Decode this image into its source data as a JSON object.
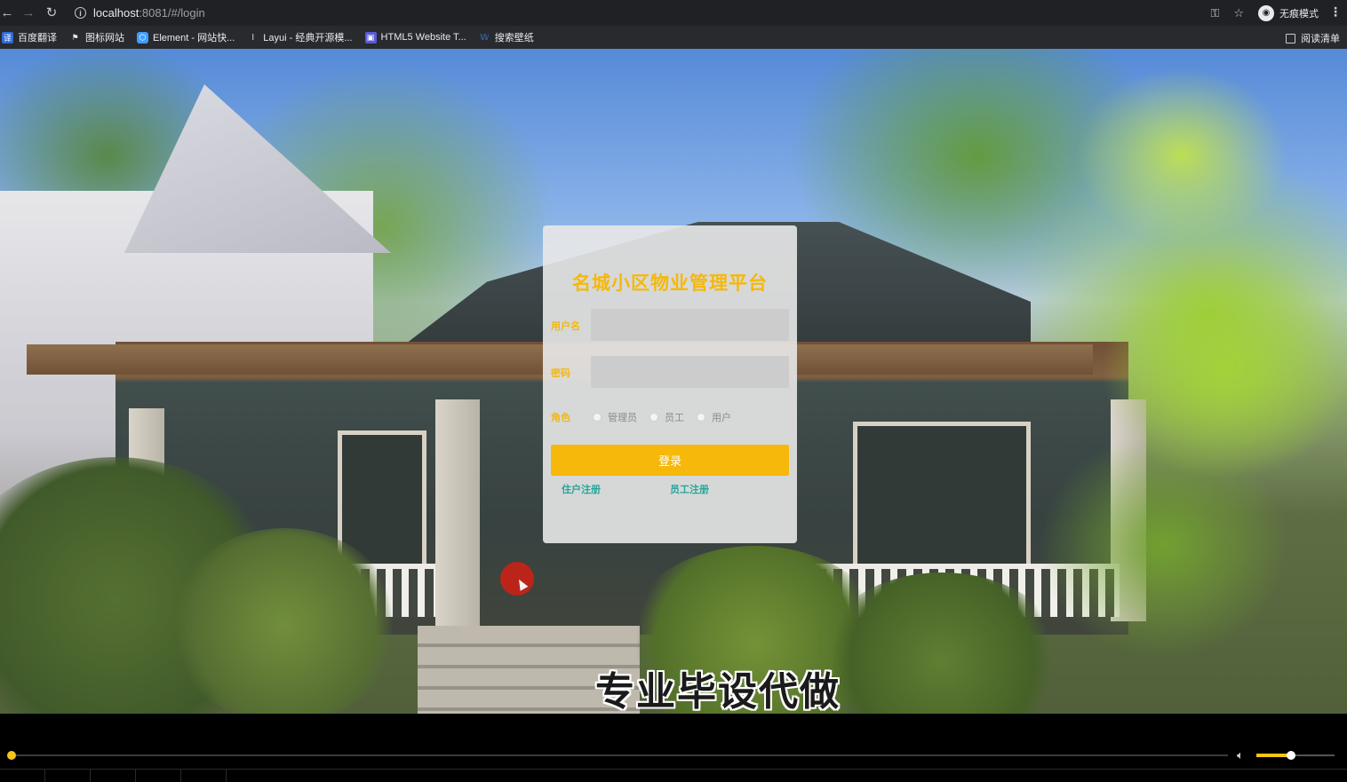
{
  "browser": {
    "url_host": "localhost",
    "url_path": ":8081/#/login",
    "incognito_label": "无痕模式",
    "reading_list_label": "阅读清单",
    "bookmarks": [
      {
        "label": "百度翻译",
        "icon": "translate-icon",
        "color": "#2e6bd8"
      },
      {
        "label": "图标网站",
        "icon": "flag-icon",
        "color": "#222222"
      },
      {
        "label": "Element - 网站快...",
        "icon": "element-icon",
        "color": "#409eff"
      },
      {
        "label": "Layui - 经典开源模...",
        "icon": "layui-icon",
        "color": "#777777"
      },
      {
        "label": "HTML5 Website T...",
        "icon": "html5-icon",
        "color": "#5b5bd6"
      },
      {
        "label": "搜索壁纸",
        "icon": "wallpaper-icon",
        "color": "#3b82f6"
      }
    ]
  },
  "login": {
    "title": "名城小区物业管理平台",
    "username_label": "用户名",
    "username_value": "",
    "password_label": "密码",
    "password_value": "",
    "role_label": "角色",
    "roles": [
      "管理员",
      "员工",
      "用户"
    ],
    "submit_label": "登录",
    "resident_register": "住户注册",
    "staff_register": "员工注册"
  },
  "overlay": {
    "caption": "专业毕设代做"
  },
  "player": {
    "progress": 0.0,
    "volume": 0.43
  },
  "colors": {
    "accent": "#f5b80a",
    "link": "#26a69a"
  }
}
